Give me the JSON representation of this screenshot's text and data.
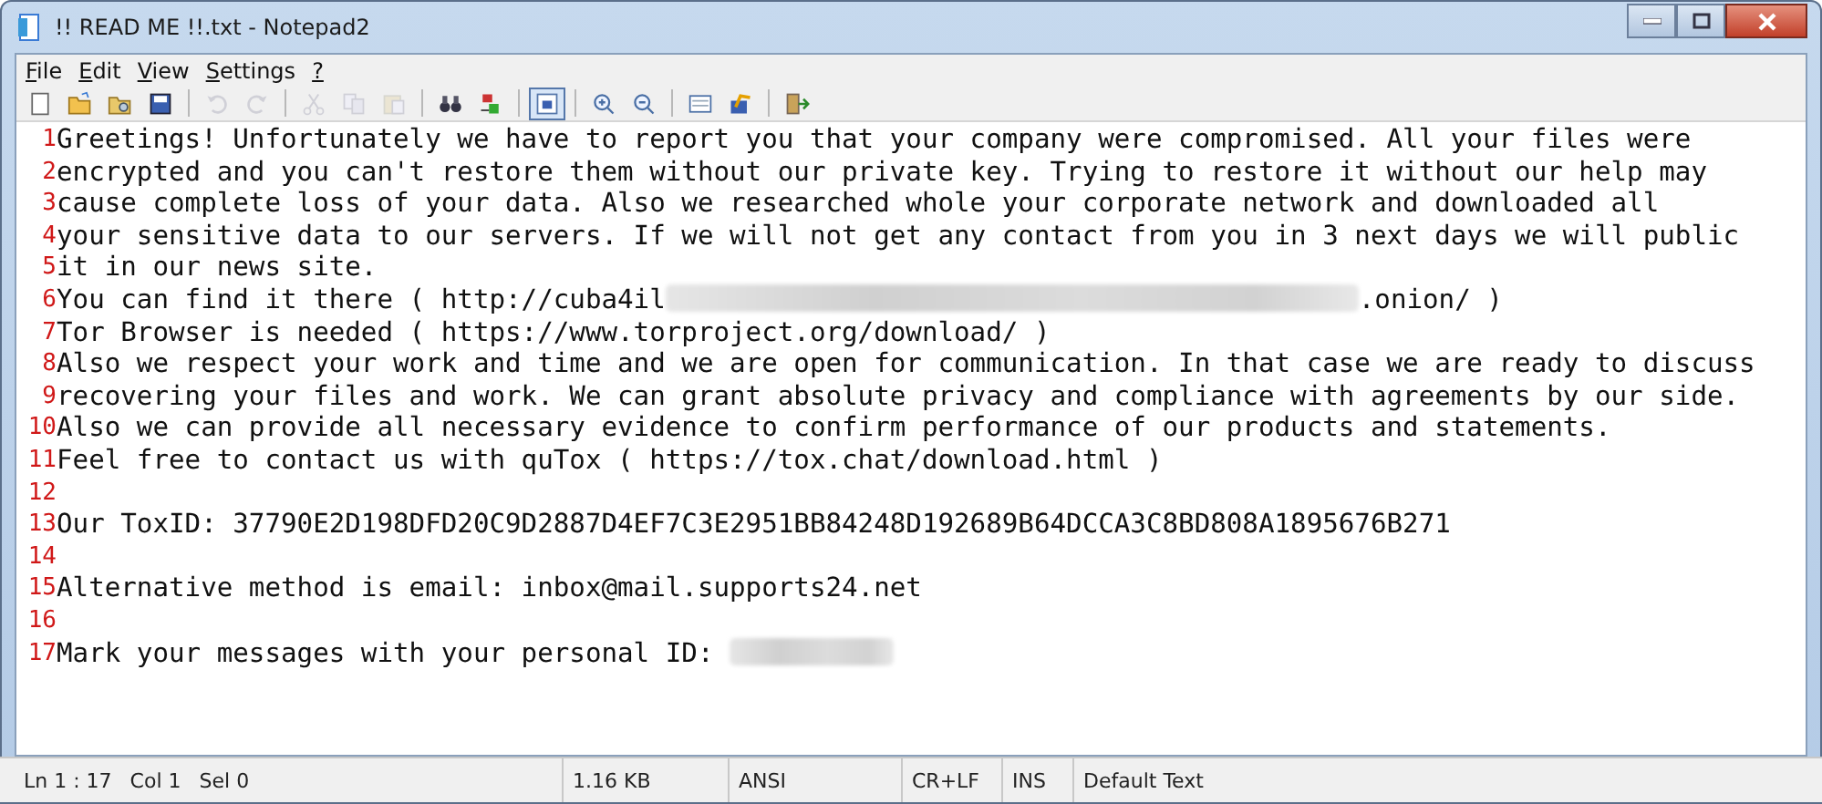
{
  "window": {
    "title": "!! READ ME !!.txt - Notepad2"
  },
  "menu": [
    "File",
    "Edit",
    "View",
    "Settings",
    "?"
  ],
  "toolbar": [
    {
      "kind": "new"
    },
    {
      "kind": "open"
    },
    {
      "kind": "browse"
    },
    {
      "kind": "save"
    },
    {
      "kind": "separator"
    },
    {
      "kind": "undo",
      "disabled": true
    },
    {
      "kind": "redo",
      "disabled": true
    },
    {
      "kind": "separator"
    },
    {
      "kind": "cut",
      "disabled": true
    },
    {
      "kind": "copy",
      "disabled": true
    },
    {
      "kind": "paste",
      "disabled": true
    },
    {
      "kind": "separator"
    },
    {
      "kind": "find"
    },
    {
      "kind": "replace"
    },
    {
      "kind": "separator"
    },
    {
      "kind": "wrap",
      "pressed": true
    },
    {
      "kind": "separator"
    },
    {
      "kind": "zoom-in"
    },
    {
      "kind": "zoom-out"
    },
    {
      "kind": "separator"
    },
    {
      "kind": "scheme"
    },
    {
      "kind": "customize"
    },
    {
      "kind": "separator"
    },
    {
      "kind": "exit"
    }
  ],
  "lines": [
    {
      "number": "1",
      "text": "Greetings! Unfortunately we have to report you that your company were compromised. All your files were"
    },
    {
      "number": "2",
      "text": "encrypted and you can't restore them without our private key. Trying to restore it without our help may"
    },
    {
      "number": "3",
      "text": "cause complete loss of your data. Also we researched whole your corporate network and downloaded all"
    },
    {
      "number": "4",
      "text": "your sensitive data to our servers. If we will not get any contact from you in 3 next days we will public"
    },
    {
      "number": "5",
      "text": "it in our news site."
    },
    {
      "number": "6",
      "text": "You can find it there ( http://cuba4il",
      "redacted": true,
      "text_after": ".onion/ )"
    },
    {
      "number": "7",
      "text": "Tor Browser is needed ( https://www.torproject.org/download/ )"
    },
    {
      "number": "8",
      "text": "Also we respect your work and time and we are open for communication. In that case we are ready to discuss"
    },
    {
      "number": "9",
      "text": "recovering your files and work. We can grant absolute privacy and compliance with agreements by our side."
    },
    {
      "number": "10",
      "text": "Also we can provide all necessary evidence to confirm performance of our products and statements."
    },
    {
      "number": "11",
      "text": "Feel free to contact us with quTox ( https://tox.chat/download.html )"
    },
    {
      "number": "12"
    },
    {
      "number": "13",
      "text": "Our ToxID: 37790E2D198DFD20C9D2887D4EF7C3E2951BB84248D192689B64DCCA3C8BD808A1895676B271"
    },
    {
      "number": "14"
    },
    {
      "number": "15",
      "text": "Alternative method is email: inbox@mail.supports24.net"
    },
    {
      "number": "16"
    },
    {
      "number": "17",
      "text": "Mark your messages with your personal ID: ",
      "redacted": true
    }
  ],
  "status_bar": [
    {
      "texts": [
        "Ln 1 : 17",
        "Col 1",
        "Sel 0"
      ]
    },
    {
      "texts": [
        "1.16 KB"
      ]
    },
    {
      "texts": [
        "ANSI"
      ]
    },
    {
      "texts": [
        "CR+LF"
      ]
    },
    {
      "texts": [
        "INS"
      ]
    },
    {
      "texts": [
        "Default Text"
      ]
    }
  ]
}
